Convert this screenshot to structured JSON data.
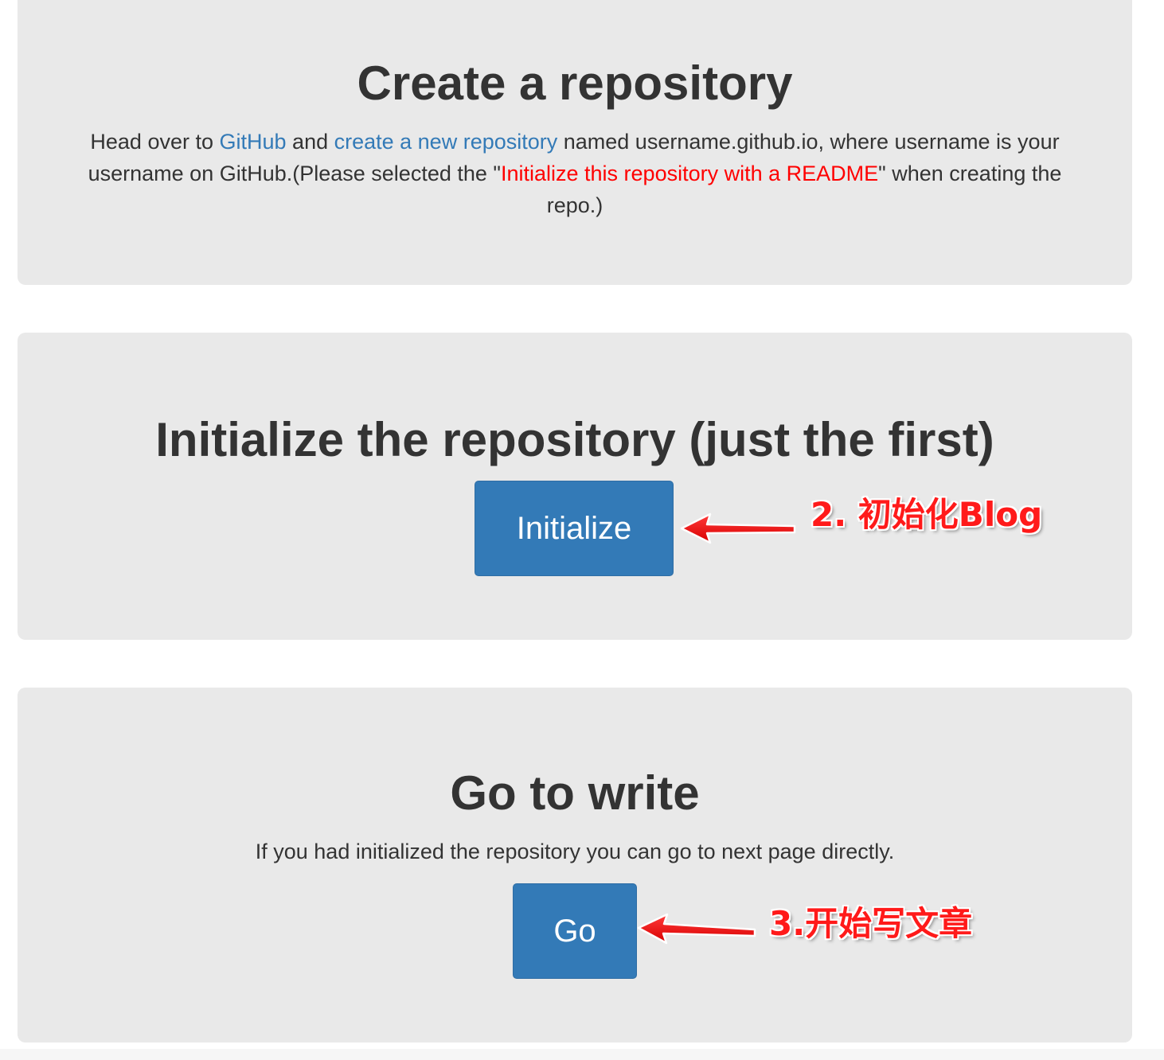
{
  "create_section": {
    "title": "Create a repository",
    "text_1": "Head over to ",
    "github_link": "GitHub",
    "text_2": " and ",
    "new_repo_link": "create a new repository",
    "text_3": " named username.github.io, where username is your username on GitHub.(Please selected the \"",
    "readme_highlight": "Initialize this repository with a README",
    "text_4": "\" when creating the repo.)"
  },
  "initialize_section": {
    "title": "Initialize the repository (just the first)",
    "button_label": "Initialize"
  },
  "go_section": {
    "title": "Go to write",
    "description": "If you had initialized the repository you can go to next page directly.",
    "button_label": "Go"
  },
  "annotations": {
    "initialize_note": "2. 初始化Blog",
    "go_note": "3.开始写文章",
    "color": "#ff1a1a"
  },
  "colors": {
    "panel_background": "#e9e9e9",
    "button_primary": "#337ab7",
    "link": "#337ab7",
    "highlight_red": "#ff0000"
  }
}
